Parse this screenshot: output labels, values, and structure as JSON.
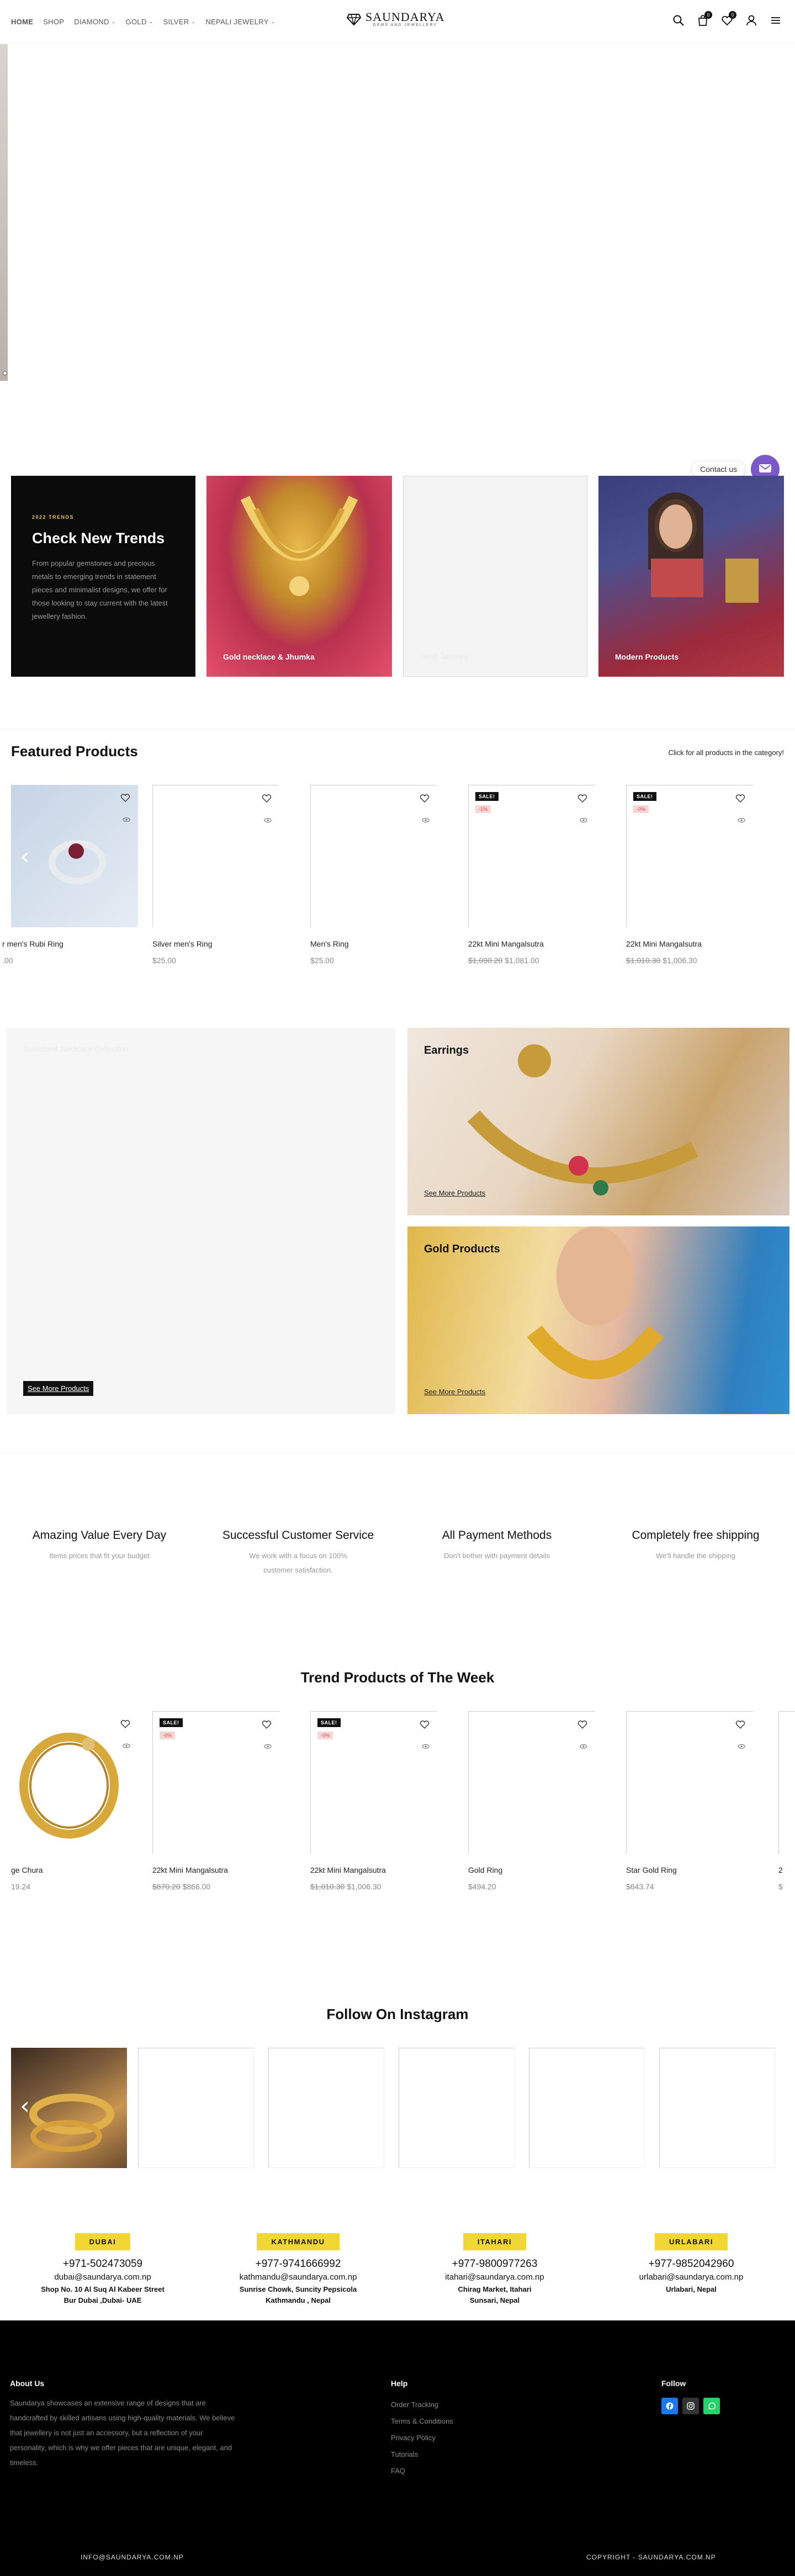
{
  "header": {
    "nav": [
      {
        "label": "HOME",
        "dropdown": false,
        "active": true
      },
      {
        "label": "SHOP",
        "dropdown": false,
        "active": false
      },
      {
        "label": "DIAMOND",
        "dropdown": true,
        "active": false
      },
      {
        "label": "GOLD",
        "dropdown": true,
        "active": false
      },
      {
        "label": "SILVER",
        "dropdown": true,
        "active": false
      },
      {
        "label": "NEPALI JEWELRY",
        "dropdown": true,
        "active": false
      }
    ],
    "logo_title": "SAUNDARYA",
    "logo_sub": "GEMS AND JEWELLERY",
    "cart_count": "0",
    "wishlist_count": "0",
    "icons": [
      "search-icon",
      "bag-icon",
      "heart-icon",
      "user-icon",
      "menu-icon"
    ]
  },
  "contact": {
    "label": "Contact us"
  },
  "trends": {
    "kicker": "2022 TRENDS",
    "title": "Check New Trends",
    "text": "From popular gemstones and precious metals to emerging trends in statement pieces and minimalist designs, we offer for those looking to stay current with the latest jewellery fashion.",
    "cards": [
      {
        "label": "Gold necklace & Jhumka"
      },
      {
        "label": "Gold Jewelry"
      },
      {
        "label": "Modern Products"
      }
    ]
  },
  "featured": {
    "title": "Featured Products",
    "sub": "Click for all products in the category!",
    "products": [
      {
        "name": "r men's Rubi Ring",
        "old_price": "",
        "price": ".00",
        "sale": false,
        "pct": ""
      },
      {
        "name": "Silver men's Ring",
        "old_price": "",
        "price": "$25.00",
        "sale": false,
        "pct": ""
      },
      {
        "name": "Men's Ring",
        "old_price": "",
        "price": "$25.00",
        "sale": false,
        "pct": ""
      },
      {
        "name": "22kt Mini Mangalsutra",
        "old_price": "$1,090.20",
        "price": "$1,081.00",
        "sale": true,
        "pct": "-1%"
      },
      {
        "name": "22kt Mini Mangalsutra",
        "old_price": "$1,010.30",
        "price": "$1,006.30",
        "sale": true,
        "pct": "-0%"
      }
    ]
  },
  "banners": {
    "left_title": "Statement Necklace Collection",
    "left_link": "See More Products",
    "earrings_title": "Earrings",
    "earrings_link": "See More Products",
    "gold_title": "Gold Products",
    "gold_link": "See More Products"
  },
  "features": [
    {
      "title": "Amazing Value Every Day",
      "text": "Items prices that fit your budget"
    },
    {
      "title": "Successful Customer Service",
      "text": "We work with a focus on 100% customer satisfaction."
    },
    {
      "title": "All Payment Methods",
      "text": "Don't bother with payment details"
    },
    {
      "title": "Completely free shipping",
      "text": "We'll handle the shipping"
    }
  ],
  "trend_week": {
    "title": "Trend Products of The Week",
    "products": [
      {
        "name": "ge Chura",
        "old_price": "",
        "price": "19.24",
        "sale": false,
        "pct": ""
      },
      {
        "name": "22kt Mini Mangalsutra",
        "old_price": "$870.20",
        "price": "$866.00",
        "sale": true,
        "pct": "-0%"
      },
      {
        "name": "22kt Mini Mangalsutra",
        "old_price": "$1,010.30",
        "price": "$1,006.30",
        "sale": true,
        "pct": "-0%"
      },
      {
        "name": "Gold Ring",
        "old_price": "",
        "price": "$494.20",
        "sale": false,
        "pct": ""
      },
      {
        "name": "Star Gold Ring",
        "old_price": "",
        "price": "$643.74",
        "sale": false,
        "pct": ""
      },
      {
        "name": "2",
        "old_price": "",
        "price": "$",
        "sale": false,
        "pct": ""
      }
    ]
  },
  "instagram": {
    "title": "Follow On Instagram"
  },
  "locations": [
    {
      "city": "DUBAI",
      "phone": "+971-502473059",
      "email": "dubai@saundarya.com.np",
      "addr1": "Shop No. 10 Al Suq Al Kabeer Street",
      "addr2": "Bur Dubai ,Dubai- UAE"
    },
    {
      "city": "KATHMANDU",
      "phone": "+977-9741666992",
      "email": "kathmandu@saundarya.com.np",
      "addr1": "Sunrise Chowk, Suncity Pepsicola",
      "addr2": "Kathmandu , Nepal"
    },
    {
      "city": "ITAHARI",
      "phone": "+977-9800977263",
      "email": "itahari@saundarya.com.np",
      "addr1": "Chirag Market, Itahari",
      "addr2": "Sunsari, Nepal"
    },
    {
      "city": "URLABARI",
      "phone": "+977-9852042960",
      "email": "urlabari@saundarya.com.np",
      "addr1": "Urlabari, Nepal",
      "addr2": ""
    }
  ],
  "footer": {
    "about_title": "About Us",
    "about_text": "Saundarya showcases an extensive range of designs that are handcrafted by skilled artisans using high-quality materials. We believe that jewellery is not just an accessory, but a reflection of your personality, which is why we offer pieces that are unique, elegant, and timeless.",
    "help_title": "Help",
    "help_links": [
      "Order Tracking",
      "Terms & Conditions",
      "Privacy Policy",
      "Tutorials",
      "FAQ"
    ],
    "follow_title": "Follow",
    "social": [
      {
        "icon": "facebook-icon",
        "color": "#1877f2"
      },
      {
        "icon": "instagram-icon",
        "color": "#333333"
      },
      {
        "icon": "whatsapp-icon",
        "color": "#25d366"
      }
    ],
    "email": "INFO@SAUNDARYA.COM.NP",
    "copyright": "COPYRIGHT - SAUNDARYA.COM.NP"
  },
  "colors": {
    "accent_yellow": "#f0d733",
    "contact_purple": "#7b59c9",
    "sale_badge": "#111111",
    "pct_badge_text": "#d64545"
  }
}
